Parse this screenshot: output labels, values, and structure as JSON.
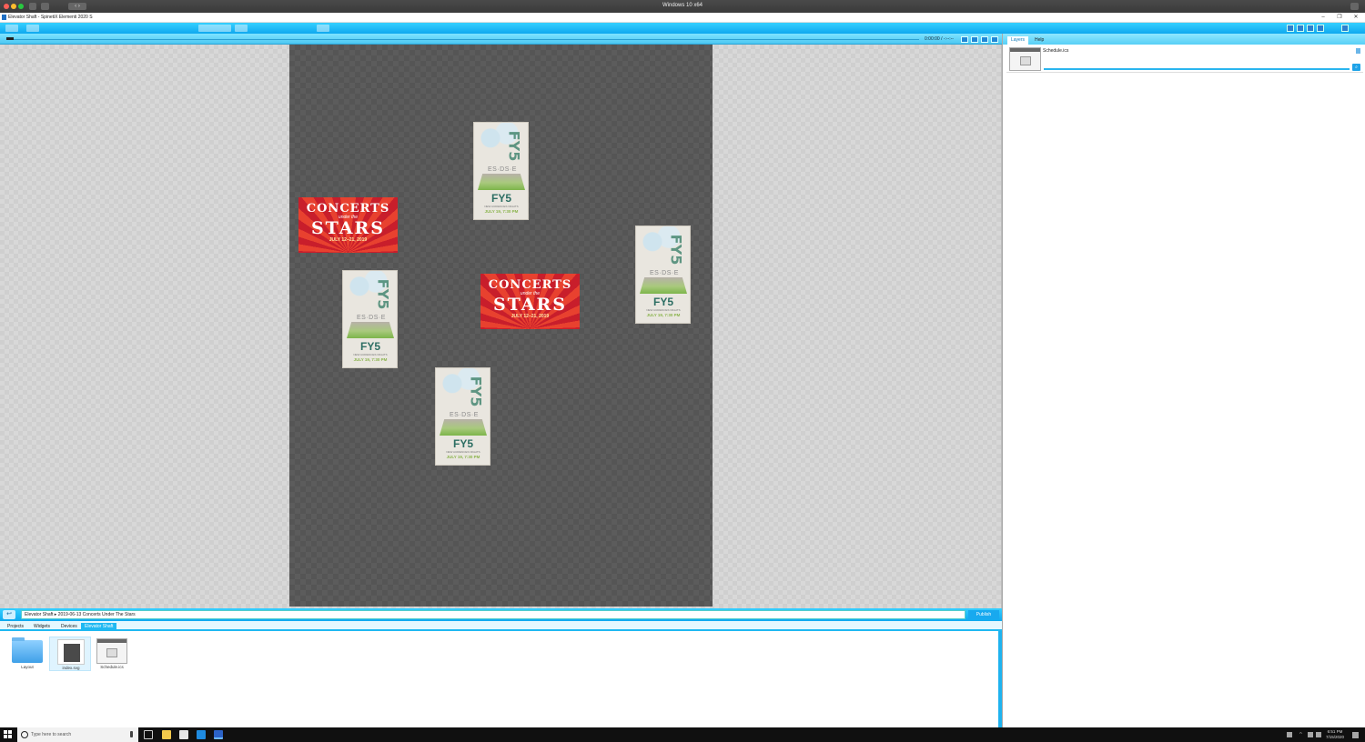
{
  "host": {
    "title": "Windows 10 x64"
  },
  "window": {
    "title": "Elevator Shaft - SpinetiX Elementi 2020 S",
    "minimize": "–",
    "maximize": "❐",
    "close": "✕"
  },
  "timeline": {
    "time": "0:00:00 / -:--:--"
  },
  "canvas": {
    "concert": {
      "line1": "CONCERTS",
      "line2": "under the",
      "line3": "STARS",
      "dates": "JULY 12–21, 2019"
    },
    "fy5": {
      "side": "FY5",
      "middle": "ES·DS·E",
      "title": "FY5",
      "subtitle": "NEW AUDIENCES NIGHTS",
      "date": "JULY 19, 7:30 PM"
    }
  },
  "breadcrumb": {
    "path": "Elevator Shaft  ▸  2019-06-13 Concerts Under The Stars",
    "publish": "Publish"
  },
  "tabs": [
    "Projects",
    "Widgets",
    "Devices",
    "Elevator Shaft"
  ],
  "files": [
    {
      "label": "Layout",
      "type": "folder"
    },
    {
      "label": "index.svg",
      "type": "svg"
    },
    {
      "label": "Schedule.ics",
      "type": "ics"
    }
  ],
  "right_panel": {
    "tabs": [
      "Layers",
      "Help"
    ],
    "layer_name": "Schedule.ics"
  },
  "taskbar": {
    "search_placeholder": "Type here to search",
    "time": "6:51 PM",
    "date": "7/15/2020"
  },
  "colors": {
    "accent": "#1fb3ef",
    "stage": "#5c5c5c",
    "concert_red": "#c81e2b",
    "fy5_green": "#2d6e63"
  }
}
